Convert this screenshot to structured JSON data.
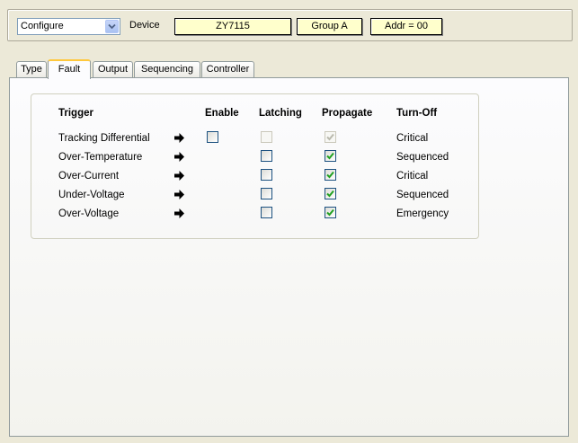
{
  "device_bar": {
    "mode_select": {
      "value": "Configure"
    },
    "device_label": "Device",
    "device_id": "ZY7115",
    "group": "Group A",
    "address": "Addr = 00"
  },
  "tabs": [
    {
      "label": "Type",
      "active": false
    },
    {
      "label": "Fault",
      "active": true
    },
    {
      "label": "Output",
      "active": false
    },
    {
      "label": "Sequencing",
      "active": false
    },
    {
      "label": "Controller",
      "active": false
    }
  ],
  "fault_table": {
    "headers": {
      "trigger": "Trigger",
      "enable": "Enable",
      "latching": "Latching",
      "propagate": "Propagate",
      "turnoff": "Turn-Off"
    },
    "rows": [
      {
        "trigger": "Tracking Differential",
        "enable": {
          "shown": true,
          "checked": false,
          "disabled": false
        },
        "latching": {
          "checked": false,
          "disabled": true
        },
        "propagate": {
          "checked": true,
          "disabled": true
        },
        "turnoff": "Critical"
      },
      {
        "trigger": "Over-Temperature",
        "enable": {
          "shown": false
        },
        "latching": {
          "checked": false,
          "disabled": false
        },
        "propagate": {
          "checked": true,
          "disabled": false
        },
        "turnoff": "Sequenced"
      },
      {
        "trigger": "Over-Current",
        "enable": {
          "shown": false
        },
        "latching": {
          "checked": false,
          "disabled": false
        },
        "propagate": {
          "checked": true,
          "disabled": false
        },
        "turnoff": "Critical"
      },
      {
        "trigger": "Under-Voltage",
        "enable": {
          "shown": false
        },
        "latching": {
          "checked": false,
          "disabled": false
        },
        "propagate": {
          "checked": true,
          "disabled": false
        },
        "turnoff": "Sequenced"
      },
      {
        "trigger": "Over-Voltage",
        "enable": {
          "shown": false
        },
        "latching": {
          "checked": false,
          "disabled": false
        },
        "propagate": {
          "checked": true,
          "disabled": false
        },
        "turnoff": "Emergency"
      }
    ]
  },
  "colors": {
    "window_bg": "#ece9d8",
    "info_box_bg": "#ffffcc",
    "active_tab_accent": "#ffc83c",
    "checkbox_border": "#1c5180",
    "checkmark": "#21a121"
  },
  "icons": {
    "row_arrow": "right-arrow-icon",
    "dropdown": "chevron-down-icon",
    "checkbox_mark": "checkmark-icon"
  }
}
